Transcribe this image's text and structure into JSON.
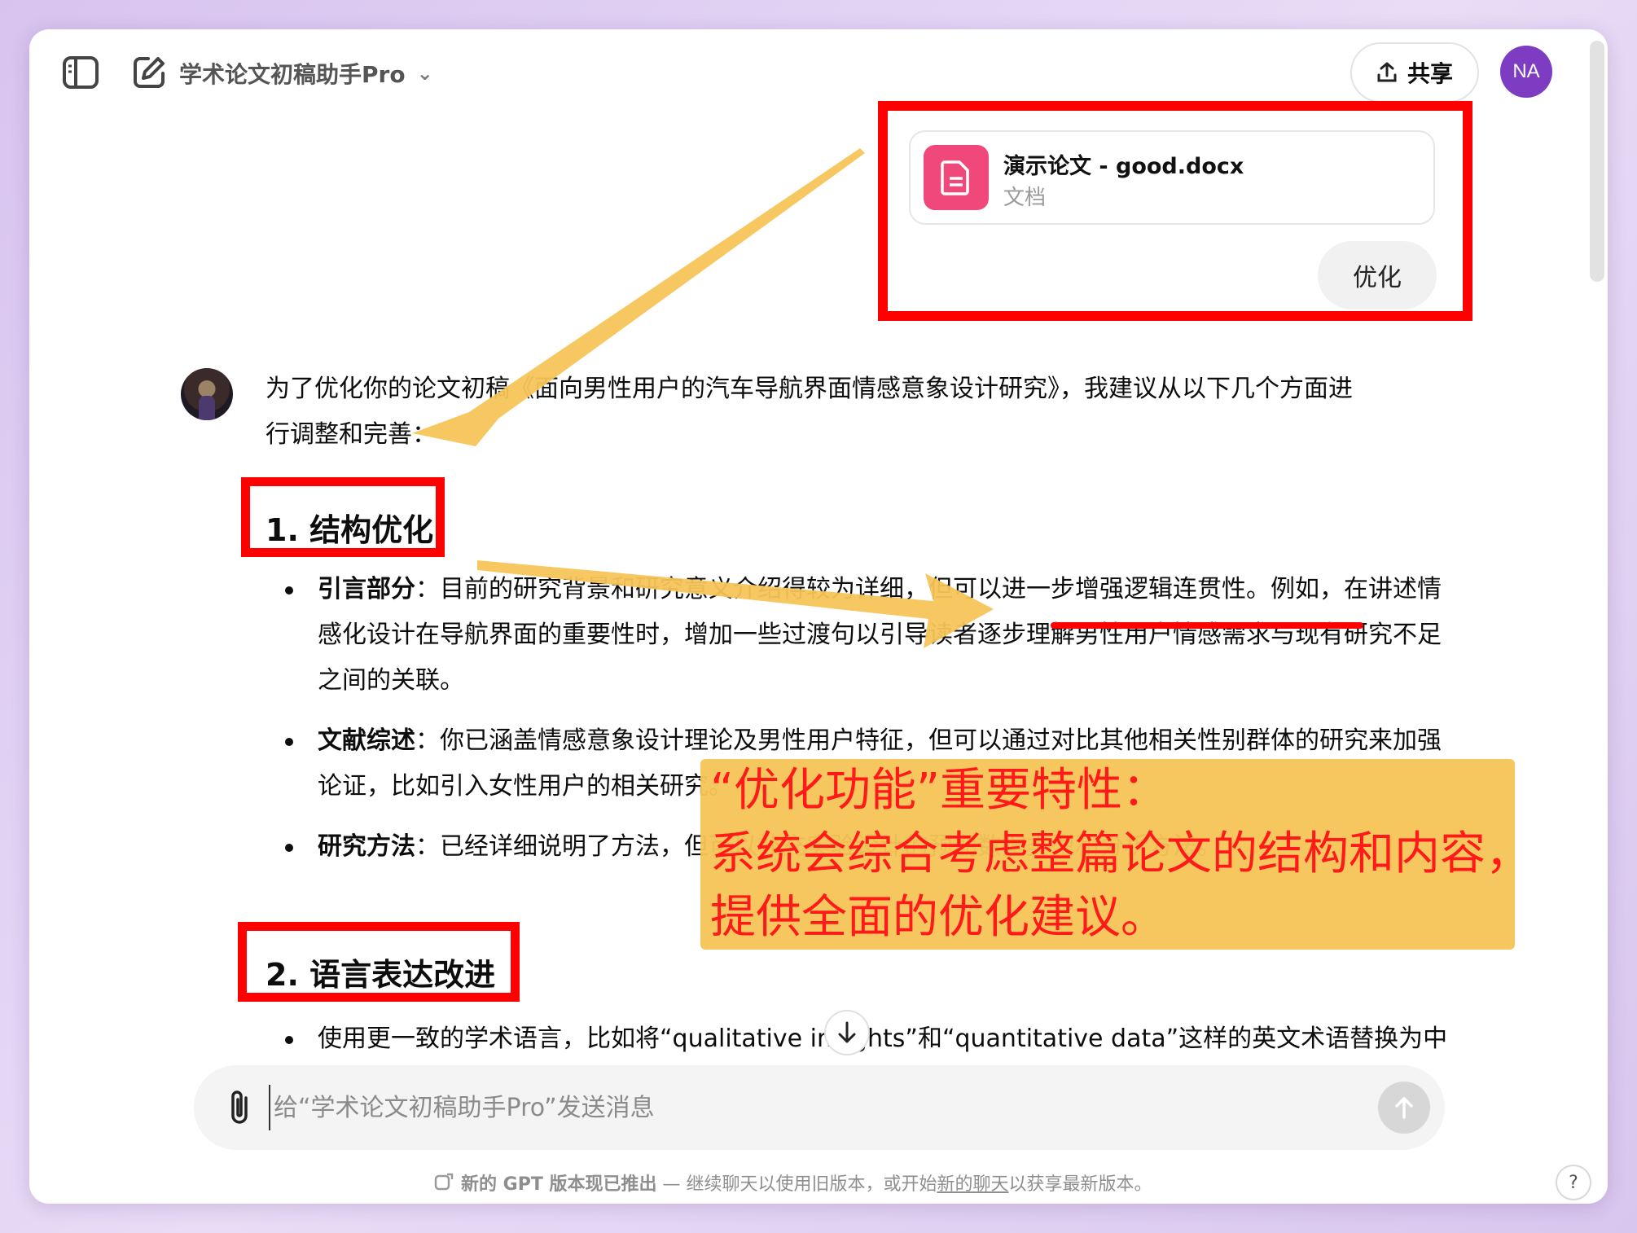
{
  "header": {
    "gpt_name": "学术论文初稿助手Pro",
    "share_label": "共享",
    "user_initials": "NA"
  },
  "user_message": {
    "file_name": "演示论文 - good.docx",
    "file_type": "文档",
    "text": "优化"
  },
  "assistant": {
    "intro_line1": "为了优化你的论文初稿《面向男性用户的汽车导航界面情感意象设计研究》，我建议从以下几个方面进",
    "intro_line2": "行调整和完善：",
    "section1_title": "1. 结构优化",
    "s1_items": [
      {
        "label": "引言部分",
        "text": "：目前的研究背景和研究意义介绍得较为详细，但可以进一步增强逻辑连贯性。例如，在讲述情感化设计在导航界面的重要性时，增加一些过渡句以引导读者逐步理解男性用户情感需求与现有研究不足之间的关联。"
      },
      {
        "label": "文献综述",
        "text": "：你已涵盖情感意象设计理论及男性用户特征，但可以通过对比其他相关性别群体的研究来加强论证，比如引入女性用户的相关研究。"
      },
      {
        "label": "研究方法",
        "text": "：已经详细说明了方法，但可以补充实验设计的预期数据类型和分析方法。"
      }
    ],
    "section2_title": "2. 语言表达改进",
    "s2_items": [
      {
        "text": "使用更一致的学术语言，比如将“qualitative insights”和“quantitative data”这样的英文术语替换为中文术语，以保持论文语言的统一性。"
      }
    ]
  },
  "callout": {
    "line1": "“优化功能”重要特性：",
    "line2": "系统会综合考虑整篇论文的结构和内容，",
    "line3": "提供全面的优化建议。"
  },
  "composer": {
    "placeholder": "给“学术论文初稿助手Pro”发送消息"
  },
  "footer": {
    "bold": "新的 GPT 版本现已推出",
    "text1": " — 继续聊天以使用旧版本，或开始",
    "link": "新的聊天",
    "text2": "以获享最新版本。",
    "help": "?"
  },
  "colors": {
    "annotation_red": "#ff0000",
    "callout_bg": "#f7c558",
    "callout_text": "#ff1a1a",
    "file_icon_bg": "#f0487a",
    "avatar_bg": "#7d3cc2"
  }
}
